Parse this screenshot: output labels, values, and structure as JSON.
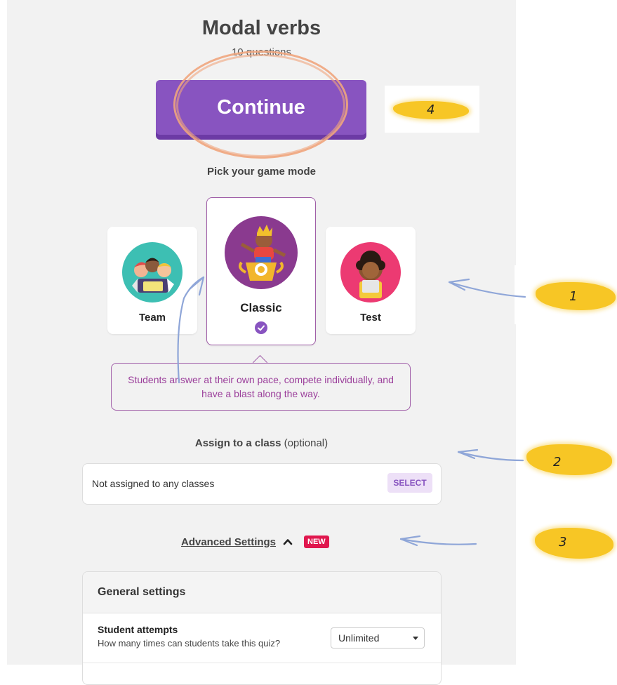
{
  "quiz": {
    "title": "Modal verbs",
    "subtitle": "10 questions"
  },
  "continue_label": "Continue",
  "pick_mode_label": "Pick your game mode",
  "modes": [
    {
      "label": "Team",
      "icon": "team-avatar-icon",
      "selected": false
    },
    {
      "label": "Classic",
      "icon": "trophy-avatar-icon",
      "selected": true
    },
    {
      "label": "Test",
      "icon": "test-avatar-icon",
      "selected": false
    }
  ],
  "mode_description": "Students answer at their own pace, compete individually, and have a blast along the way.",
  "assign": {
    "label_bold": "Assign to a class",
    "label_optional": "(optional)",
    "current": "Not assigned to any classes",
    "select_label": "SELECT"
  },
  "advanced": {
    "label": "Advanced Settings",
    "badge": "NEW"
  },
  "settings": {
    "section_title": "General settings",
    "rows": [
      {
        "title": "Student attempts",
        "description": "How many times can students take this quiz?",
        "value": "Unlimited"
      }
    ]
  },
  "annotations": [
    "1",
    "2",
    "3",
    "4"
  ],
  "colors": {
    "accent": "#8854c0",
    "selected_border": "#a05ea8",
    "badge": "#e0174e",
    "highlighter": "#f7c625",
    "annotation_arrow": "#8fa6d8",
    "annotation_circle": "#f0a57d"
  }
}
